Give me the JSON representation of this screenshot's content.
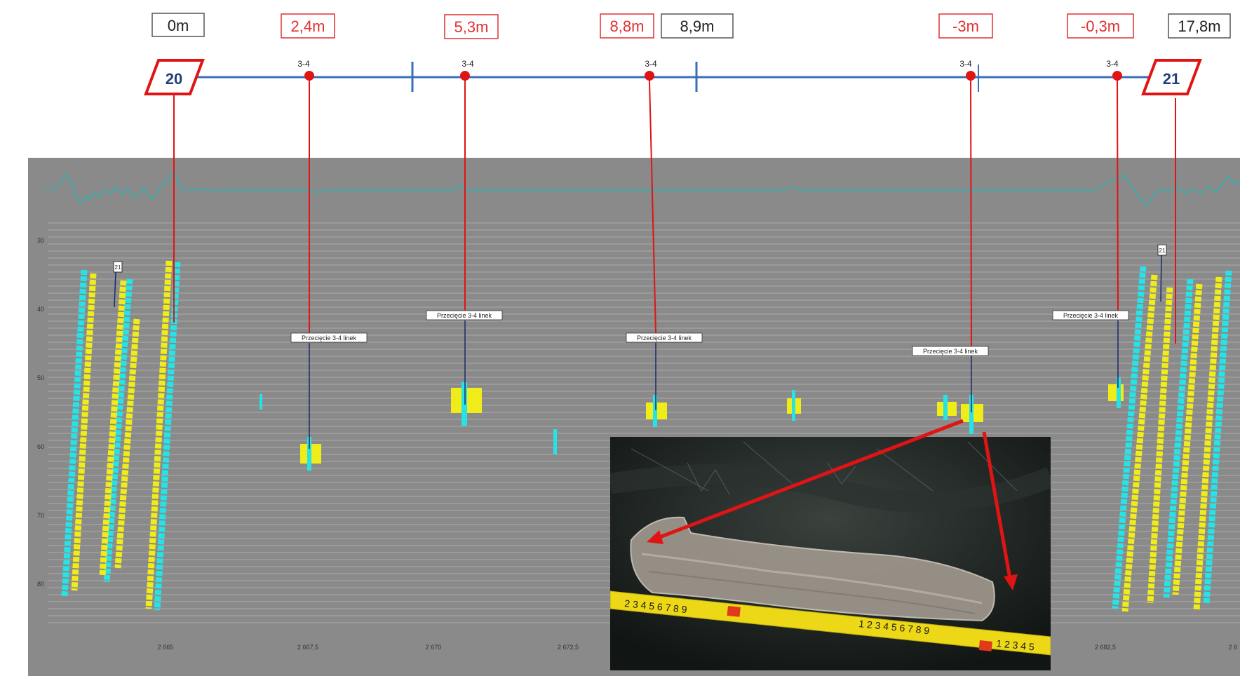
{
  "colors": {
    "rail": "#3a6fb8",
    "marker_red": "#e01414",
    "label_red": "#e03030",
    "label_black": "#222222",
    "panel_bg": "#8a8a8a",
    "trace": "#2bb3b1",
    "signal_cyan": "#25e3e6",
    "signal_yellow": "#f0ec1a",
    "photo_bg": "#1a1f1d",
    "tape": "#ecd817"
  },
  "distances": [
    {
      "id": "d0",
      "text": "0m",
      "tone": "black"
    },
    {
      "id": "d1",
      "text": "2,4m",
      "tone": "red"
    },
    {
      "id": "d2",
      "text": "5,3m",
      "tone": "red"
    },
    {
      "id": "d3",
      "text": "8,8m",
      "tone": "red"
    },
    {
      "id": "d4",
      "text": "8,9m",
      "tone": "black"
    },
    {
      "id": "d5",
      "text": "-3m",
      "tone": "red"
    },
    {
      "id": "d6",
      "text": "-0,3m",
      "tone": "red"
    },
    {
      "id": "d7",
      "text": "17,8m",
      "tone": "black"
    }
  ],
  "supports": [
    {
      "id": "s20",
      "text": "20"
    },
    {
      "id": "s21",
      "text": "21"
    }
  ],
  "defects": [
    {
      "id": "m1",
      "type_label": "3-4",
      "annotation": "Przecięcie 3-4 linek"
    },
    {
      "id": "m2",
      "type_label": "3-4",
      "annotation": "Przecięcie 3-4 linek"
    },
    {
      "id": "m3",
      "type_label": "3-4",
      "annotation": "Przecięcie 3-4 linek"
    },
    {
      "id": "m4",
      "type_label": "3-4",
      "annotation": "Przecięcie 3-4 linek"
    },
    {
      "id": "m5",
      "type_label": "3-4",
      "annotation": "Przecięcie 3-4 linek"
    }
  ],
  "plot": {
    "y_ticks": [
      "30",
      "40",
      "50",
      "60",
      "70",
      "80"
    ],
    "x_ticks": [
      "2 665",
      "2 667,5",
      "2 670",
      "2 672,5",
      "2 682,5",
      "2 6"
    ],
    "small_boxes": [
      "21",
      "21"
    ]
  },
  "photo": {
    "tape_numbers_a": "2 3 4 5 6 7 8 9",
    "tape_numbers_b": "1 2 3 4 5 6 7 8 9",
    "tape_numbers_c": "1 2 3 4 5"
  }
}
